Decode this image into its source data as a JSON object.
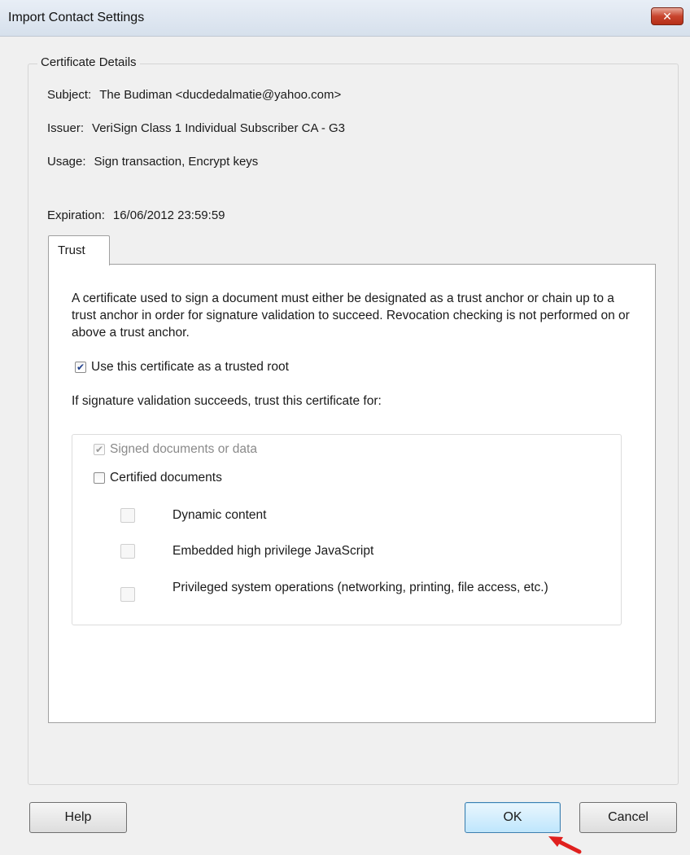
{
  "window": {
    "title": "Import Contact Settings",
    "close_label": "✕"
  },
  "certificate_details": {
    "legend": "Certificate Details",
    "subject": {
      "label": "Subject:",
      "value": "The Budiman <ducdedalmatie@yahoo.com>"
    },
    "issuer": {
      "label": "Issuer:",
      "value": "VeriSign Class 1 Individual Subscriber CA - G3"
    },
    "usage": {
      "label": "Usage:",
      "value": "Sign transaction, Encrypt keys"
    },
    "expiration": {
      "label": "Expiration:",
      "value": "16/06/2012 23:59:59"
    }
  },
  "tabs": [
    {
      "label": "Trust",
      "selected": true
    }
  ],
  "trust": {
    "description": "A certificate used to sign a document must either be designated as a trust anchor or chain up to a trust anchor in order for signature validation to succeed.  Revocation checking is not performed on or above a trust anchor.",
    "trusted_root": {
      "label": "Use this certificate as a trusted root",
      "checked": true
    },
    "trust_for_label": "If signature validation succeeds, trust this certificate for:",
    "options": {
      "signed_documents": {
        "label": "Signed documents or data",
        "checked": true,
        "disabled": true
      },
      "certified_documents": {
        "label": "Certified documents",
        "checked": false
      },
      "dynamic_content": {
        "label": "Dynamic content",
        "checked": false,
        "disabled": true
      },
      "embedded_javascript": {
        "label": "Embedded high privilege JavaScript",
        "checked": false,
        "disabled": true
      },
      "system_operations": {
        "label": "Privileged system operations (networking, printing, file access, etc.)",
        "checked": false,
        "disabled": true
      }
    }
  },
  "buttons": {
    "help": "Help",
    "ok": "OK",
    "cancel": "Cancel"
  },
  "colors": {
    "ok_button": "#bee6fd",
    "close_button": "#c8442d",
    "arrow": "#e0201e"
  }
}
